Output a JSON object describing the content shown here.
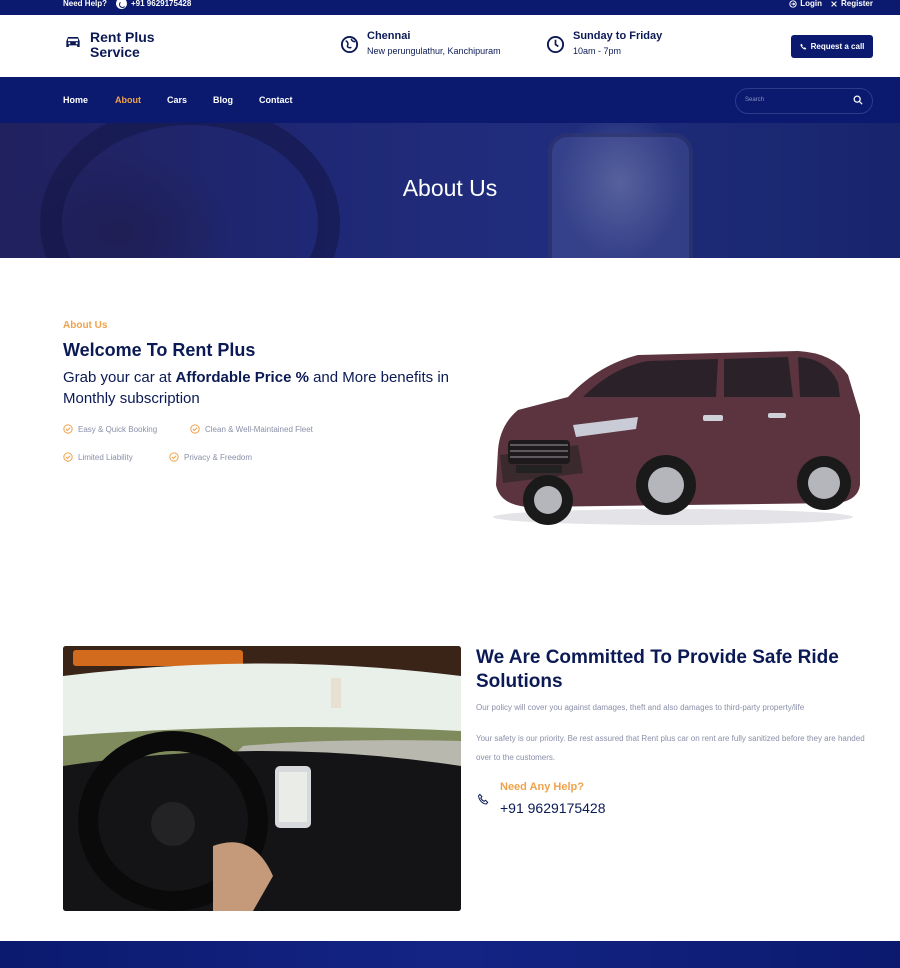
{
  "topbar": {
    "help_label": "Need Help?",
    "phone": "+91 9629175428",
    "login_label": "Login",
    "register_label": "Register"
  },
  "brand": {
    "name": "Rent Plus Service"
  },
  "header": {
    "location_title": "Chennai",
    "location_sub": "New perungulathur, Kanchipuram",
    "hours_title": "Sunday to Friday",
    "hours_sub": "10am - 7pm",
    "request_label": "Request a call"
  },
  "nav": {
    "items": [
      {
        "label": "Home"
      },
      {
        "label": "About"
      },
      {
        "label": "Cars"
      },
      {
        "label": "Blog"
      },
      {
        "label": "Contact"
      }
    ],
    "active": "About",
    "search_placeholder": "Search"
  },
  "banner": {
    "title": "About Us"
  },
  "about": {
    "eyebrow": "About Us",
    "title": "Welcome To Rent Plus",
    "sub_prefix": "Grab your car at ",
    "sub_bold": "Affordable Price %",
    "sub_suffix": " and More benefits in Monthly subscription",
    "features": [
      "Easy & Quick Booking",
      "Clean & Well-Maintained Fleet",
      "Limited Liability",
      "Privacy & Freedom"
    ]
  },
  "commit": {
    "title": "We Are Committed To Provide Safe Ride Solutions",
    "p1": "Our policy will cover you against damages, theft and also damages to third-party property/life",
    "p2": "Your safety is our priority. Be rest assured that Rent plus car on rent are fully sanitized before they are handed over to the customers.",
    "help_label": "Need Any Help?",
    "help_phone": "+91 9629175428"
  },
  "colors": {
    "navy": "#0b1a6e",
    "accent": "#f0a24b",
    "muted": "#8a8fa8"
  }
}
